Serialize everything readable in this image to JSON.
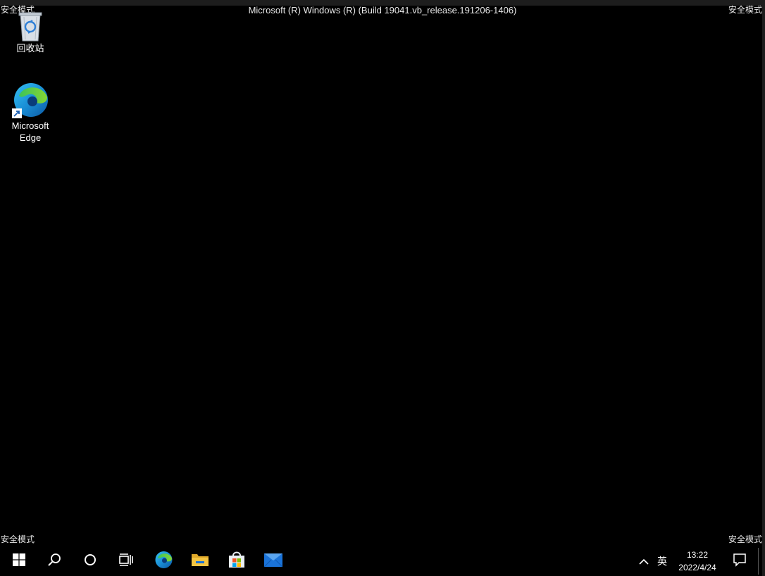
{
  "watermark": {
    "top_left": "安全模式",
    "top_right": "安全模式",
    "bottom_left": "安全模式",
    "bottom_right": "安全模式"
  },
  "build_info": "Microsoft (R) Windows (R) (Build 19041.vb_release.191206-1406)",
  "desktop_icons": [
    {
      "label": "回收站",
      "icon": "recycle-bin-icon"
    },
    {
      "label": "Microsoft\nEdge",
      "label_line1": "Microsoft",
      "label_line2": "Edge",
      "icon": "edge-icon"
    }
  ],
  "taskbar": {
    "items": [
      {
        "icon": "windows-start-icon"
      },
      {
        "icon": "search-icon"
      },
      {
        "icon": "cortana-icon"
      },
      {
        "icon": "task-view-icon"
      },
      {
        "icon": "edge-icon"
      },
      {
        "icon": "file-explorer-icon"
      },
      {
        "icon": "microsoft-store-icon"
      },
      {
        "icon": "mail-icon"
      }
    ],
    "tray": {
      "chevron_icon": "chevron-up-icon",
      "ime": "英",
      "time": "13:22",
      "date": "2022/4/24",
      "notification_icon": "action-center-icon"
    }
  },
  "colors": {
    "desktop_background": "#000000",
    "edge_blue": "#0c59a4",
    "edge_green": "#3dc35a",
    "folder_yellow": "#f4c542",
    "mail_blue": "#1a73d9"
  }
}
